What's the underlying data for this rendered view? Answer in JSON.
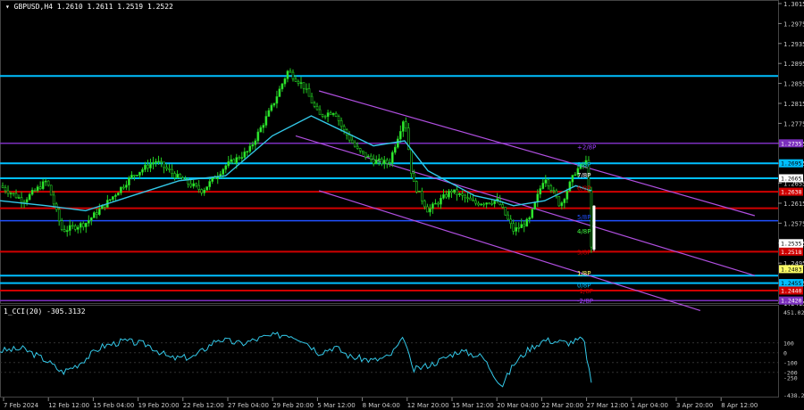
{
  "main_header": "▾ GBPUSD,H4  1.2610 1.2611 1.2519 1.2522",
  "cci_header": "1_CCI(20) -305.3132",
  "price_axis": [
    "1.3015",
    "1.2975",
    "1.2935",
    "1.2895",
    "1.2855",
    "1.2815",
    "1.2775",
    "1.2735",
    "1.2695",
    "1.2655",
    "1.2615",
    "1.2575",
    "1.2535",
    "1.2495",
    "1.2455",
    "1.2415"
  ],
  "cci_axis": [
    "451.0235",
    "100",
    "0",
    "-100",
    "-200",
    "-250",
    "-438.2698"
  ],
  "time_axis": [
    "7 Feb 2024",
    "12 Feb 12:00",
    "15 Feb 04:00",
    "19 Feb 20:00",
    "22 Feb 12:00",
    "27 Feb 04:00",
    "29 Feb 20:00",
    "5 Mar 12:00",
    "8 Mar 04:00",
    "12 Mar 20:00",
    "15 Mar 12:00",
    "20 Mar 04:00",
    "22 Mar 20:00",
    "27 Mar 12:00",
    "1 Apr 04:00",
    "3 Apr 20:00",
    "8 Apr 12:00"
  ],
  "price_tags": [
    {
      "text": "1.2735",
      "bg": "#7b2fbe",
      "fg": "#ffffff"
    },
    {
      "text": "1.2695",
      "bg": "#00bfff",
      "fg": "#000000"
    },
    {
      "text": "1.2665",
      "bg": "#ffffff",
      "fg": "#000000"
    },
    {
      "text": "1.2638",
      "bg": "#d00000",
      "fg": "#ffffff"
    },
    {
      "text": "1.2535",
      "bg": "#ffffff",
      "fg": "#000000"
    },
    {
      "text": "1.2522",
      "bg": "#ffffff",
      "fg": "#000000"
    },
    {
      "text": "1.2518",
      "bg": "#d00000",
      "fg": "#ffffff"
    },
    {
      "text": "1.2483",
      "bg": "#ffff66",
      "fg": "#000000"
    },
    {
      "text": "1.2455",
      "bg": "#00bfff",
      "fg": "#000000"
    },
    {
      "text": "1.2440",
      "bg": "#d00000",
      "fg": "#ffffff"
    },
    {
      "text": "1.2420",
      "bg": "#7b2fbe",
      "fg": "#ffffff"
    }
  ],
  "murrey_labels": [
    {
      "text": "+2/8P",
      "color": "#a040ff"
    },
    {
      "text": "8/8P",
      "color": "#00bfff"
    },
    {
      "text": "7/8P",
      "color": "#ffffff"
    },
    {
      "text": "6/8P",
      "color": "#d00000"
    },
    {
      "text": "5/8P",
      "color": "#2050ff"
    },
    {
      "text": "4/8P",
      "color": "#40ff40"
    },
    {
      "text": "3/8P",
      "color": "#d00000"
    },
    {
      "text": "1/8P",
      "color": "#ffff66"
    },
    {
      "text": "0/8P",
      "color": "#00bfff"
    },
    {
      "text": "-1/8P",
      "color": "#d00000"
    },
    {
      "text": "-2/8P",
      "color": "#a040ff"
    }
  ],
  "chart_data": {
    "type": "candlestick-with-indicator",
    "symbol": "GBPUSD",
    "timeframe": "H4",
    "ohlc_last": {
      "open": 1.261,
      "high": 1.2611,
      "low": 1.2519,
      "close": 1.2522
    },
    "ylim": [
      1.2415,
      1.3015
    ],
    "cci_ylim": [
      -438.2698,
      451.0235
    ],
    "close_path": [
      [
        0,
        1.265
      ],
      [
        0.03,
        1.262
      ],
      [
        0.06,
        1.266
      ],
      [
        0.08,
        1.256
      ],
      [
        0.11,
        1.2575
      ],
      [
        0.14,
        1.262
      ],
      [
        0.17,
        1.267
      ],
      [
        0.2,
        1.27
      ],
      [
        0.23,
        1.2665
      ],
      [
        0.26,
        1.264
      ],
      [
        0.29,
        1.269
      ],
      [
        0.32,
        1.272
      ],
      [
        0.35,
        1.281
      ],
      [
        0.37,
        1.288
      ],
      [
        0.39,
        1.285
      ],
      [
        0.41,
        1.279
      ],
      [
        0.43,
        1.28
      ],
      [
        0.44,
        1.2765
      ],
      [
        0.46,
        1.272
      ],
      [
        0.48,
        1.27
      ],
      [
        0.5,
        1.2695
      ],
      [
        0.52,
        1.279
      ],
      [
        0.53,
        1.266
      ],
      [
        0.55,
        1.26
      ],
      [
        0.58,
        1.264
      ],
      [
        0.61,
        1.2615
      ],
      [
        0.64,
        1.262
      ],
      [
        0.66,
        1.256
      ],
      [
        0.68,
        1.258
      ],
      [
        0.7,
        1.267
      ],
      [
        0.72,
        1.261
      ],
      [
        0.74,
        1.268
      ],
      [
        0.755,
        1.27
      ],
      [
        0.76,
        1.2522
      ]
    ],
    "ma_path": [
      [
        0,
        1.262
      ],
      [
        0.06,
        1.261
      ],
      [
        0.11,
        1.26
      ],
      [
        0.17,
        1.263
      ],
      [
        0.23,
        1.266
      ],
      [
        0.29,
        1.267
      ],
      [
        0.35,
        1.275
      ],
      [
        0.4,
        1.279
      ],
      [
        0.44,
        1.276
      ],
      [
        0.48,
        1.273
      ],
      [
        0.52,
        1.274
      ],
      [
        0.55,
        1.268
      ],
      [
        0.61,
        1.263
      ],
      [
        0.64,
        1.262
      ],
      [
        0.66,
        1.261
      ],
      [
        0.7,
        1.262
      ],
      [
        0.74,
        1.265
      ],
      [
        0.76,
        1.264
      ]
    ],
    "cci_path": [
      [
        0,
        20
      ],
      [
        0.03,
        40
      ],
      [
        0.06,
        -80
      ],
      [
        0.08,
        -200
      ],
      [
        0.1,
        -120
      ],
      [
        0.13,
        60
      ],
      [
        0.16,
        120
      ],
      [
        0.19,
        80
      ],
      [
        0.22,
        -60
      ],
      [
        0.25,
        -40
      ],
      [
        0.28,
        140
      ],
      [
        0.31,
        90
      ],
      [
        0.34,
        160
      ],
      [
        0.37,
        190
      ],
      [
        0.39,
        130
      ],
      [
        0.41,
        0
      ],
      [
        0.43,
        60
      ],
      [
        0.45,
        -40
      ],
      [
        0.48,
        -80
      ],
      [
        0.5,
        -40
      ],
      [
        0.52,
        150
      ],
      [
        0.53,
        -180
      ],
      [
        0.56,
        -100
      ],
      [
        0.59,
        20
      ],
      [
        0.62,
        -40
      ],
      [
        0.645,
        -340
      ],
      [
        0.66,
        -120
      ],
      [
        0.68,
        40
      ],
      [
        0.7,
        130
      ],
      [
        0.73,
        100
      ],
      [
        0.75,
        140
      ],
      [
        0.76,
        -305
      ]
    ],
    "horizontal_levels": [
      {
        "price": 1.287,
        "color": "#00bfff"
      },
      {
        "price": 1.2735,
        "color": "#7b2fbe"
      },
      {
        "price": 1.2695,
        "color": "#00bfff"
      },
      {
        "price": 1.2665,
        "color": "#00bfff"
      },
      {
        "price": 1.2638,
        "color": "#d00000"
      },
      {
        "price": 1.2605,
        "color": "#d00000"
      },
      {
        "price": 1.258,
        "color": "#2050ff"
      },
      {
        "price": 1.2518,
        "color": "#d00000"
      },
      {
        "price": 1.247,
        "color": "#00bfff"
      },
      {
        "price": 1.2455,
        "color": "#00bfff"
      },
      {
        "price": 1.244,
        "color": "#d00000"
      },
      {
        "price": 1.242,
        "color": "#7b2fbe"
      }
    ],
    "channel_lines": [
      {
        "from": [
          0.41,
          1.284
        ],
        "to": [
          0.97,
          1.259
        ]
      },
      {
        "from": [
          0.38,
          1.275
        ],
        "to": [
          0.97,
          1.247
        ]
      },
      {
        "from": [
          0.41,
          1.264
        ],
        "to": [
          0.9,
          1.24
        ]
      }
    ]
  }
}
